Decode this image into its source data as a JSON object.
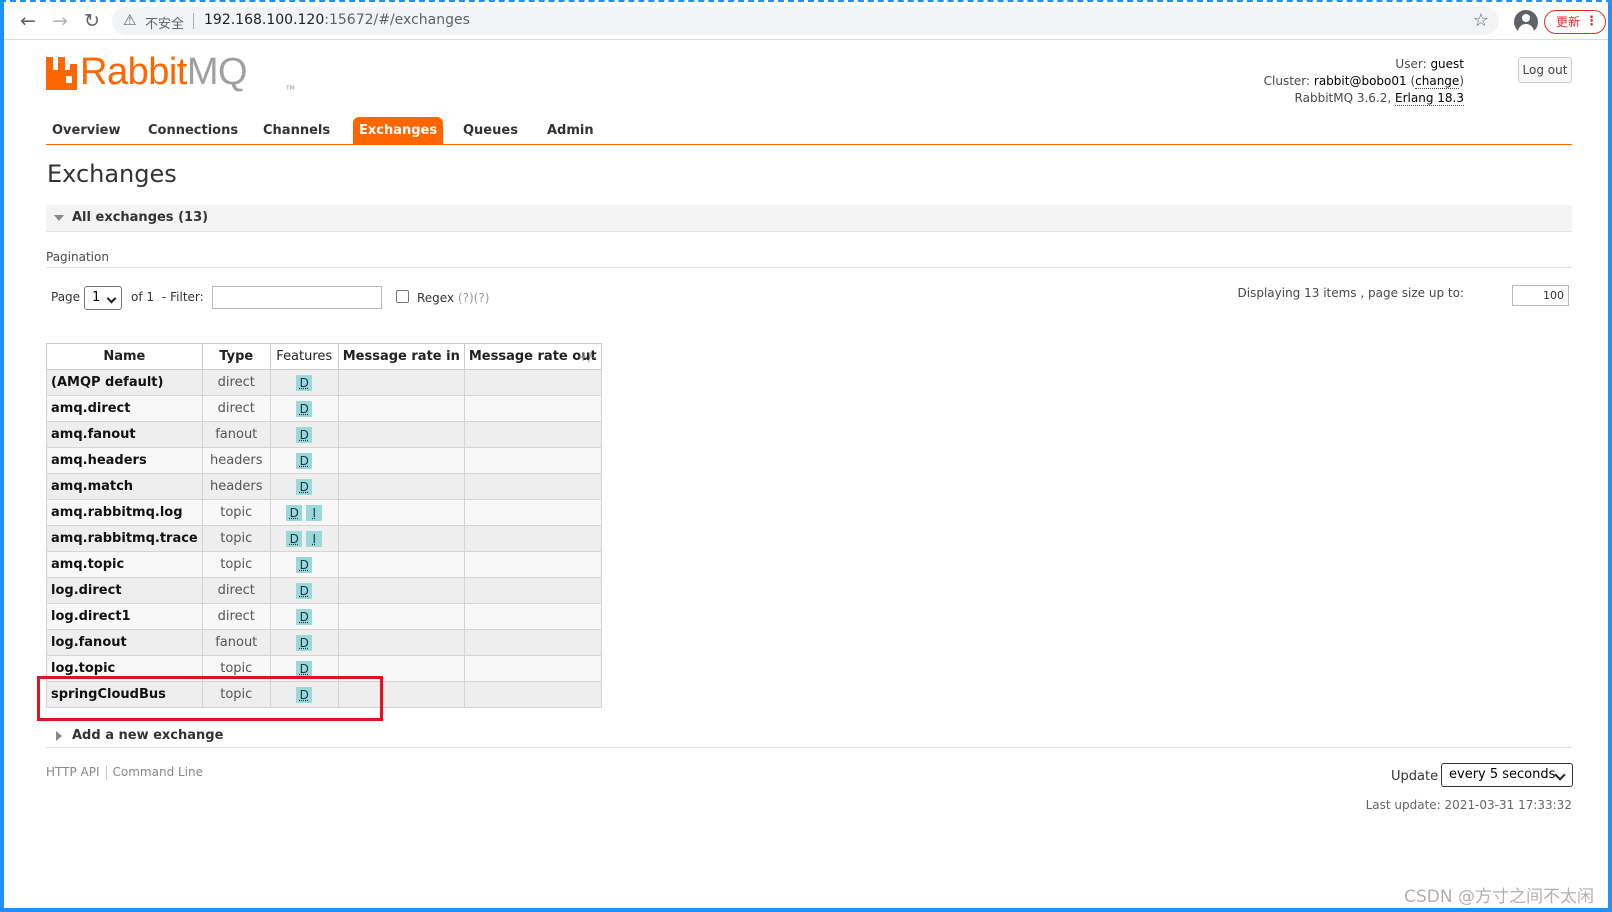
{
  "browser": {
    "insecure_label": "不安全",
    "url_host": "192.168.100.120",
    "url_rest": ":15672/#/exchanges",
    "update_button": "更新",
    "menu_glyph": "⋮"
  },
  "header": {
    "logo_rabbit": "Rabbit",
    "logo_mq": "MQ",
    "logo_tm": "TM",
    "user_label": "User:",
    "user_value": "guest",
    "cluster_label": "Cluster:",
    "cluster_value": "rabbit@bobo01",
    "change_link": "change",
    "version": "RabbitMQ 3.6.2,",
    "erlang": "Erlang 18.3",
    "logout": "Log out"
  },
  "tabs": [
    {
      "label": "Overview"
    },
    {
      "label": "Connections"
    },
    {
      "label": "Channels"
    },
    {
      "label": "Exchanges",
      "active": true
    },
    {
      "label": "Queues"
    },
    {
      "label": "Admin"
    }
  ],
  "page": {
    "title": "Exchanges",
    "section_label": "All exchanges (13)",
    "pagination_label": "Pagination"
  },
  "pager": {
    "page_label": "Page",
    "page_value": "1",
    "of_label": "of 1",
    "filter_label": "- Filter:",
    "regex_label": "Regex",
    "regex_help": "(?)(?)",
    "display_text": "Displaying 13 items , page size up to:",
    "page_size": "100"
  },
  "table": {
    "headers": [
      "Name",
      "Type",
      "Features",
      "Message rate in",
      "Message rate out"
    ],
    "toggle": "+/-",
    "rows": [
      {
        "name": "(AMQP default)",
        "type": "direct",
        "features": [
          "D"
        ]
      },
      {
        "name": "amq.direct",
        "type": "direct",
        "features": [
          "D"
        ]
      },
      {
        "name": "amq.fanout",
        "type": "fanout",
        "features": [
          "D"
        ]
      },
      {
        "name": "amq.headers",
        "type": "headers",
        "features": [
          "D"
        ]
      },
      {
        "name": "amq.match",
        "type": "headers",
        "features": [
          "D"
        ]
      },
      {
        "name": "amq.rabbitmq.log",
        "type": "topic",
        "features": [
          "D",
          "I"
        ]
      },
      {
        "name": "amq.rabbitmq.trace",
        "type": "topic",
        "features": [
          "D",
          "I"
        ]
      },
      {
        "name": "amq.topic",
        "type": "topic",
        "features": [
          "D"
        ]
      },
      {
        "name": "log.direct",
        "type": "direct",
        "features": [
          "D"
        ]
      },
      {
        "name": "log.direct1",
        "type": "direct",
        "features": [
          "D"
        ]
      },
      {
        "name": "log.fanout",
        "type": "fanout",
        "features": [
          "D"
        ]
      },
      {
        "name": "log.topic",
        "type": "topic",
        "features": [
          "D"
        ]
      },
      {
        "name": "springCloudBus",
        "type": "topic",
        "features": [
          "D"
        ]
      }
    ]
  },
  "add_exchange": "Add a new exchange",
  "footer": {
    "http_api": "HTTP API",
    "command_line": "Command Line",
    "update_label": "Update",
    "update_value": "every 5 seconds",
    "last_update": "Last update: 2021-03-31 17:33:32"
  },
  "watermark": "CSDN @方寸之间不太闲",
  "colors": {
    "brand": "#ff6600",
    "feature_badge": "#99d9d9",
    "highlight": "#e0141e",
    "frame": "#1e90ff"
  }
}
